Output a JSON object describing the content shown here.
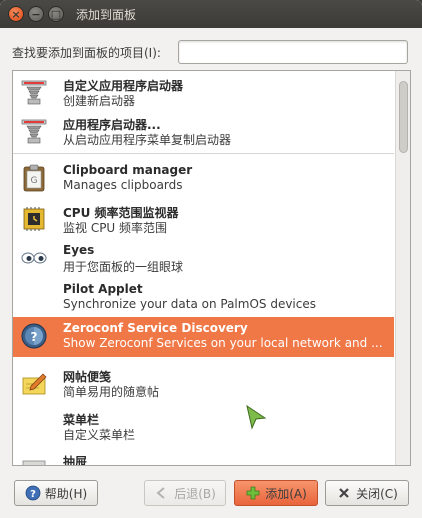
{
  "window": {
    "title": "添加到面板",
    "close_glyph": "×",
    "min_glyph": "−",
    "max_glyph": "□"
  },
  "search": {
    "label": "查找要添加到面板的项目(I):",
    "value": "",
    "placeholder": ""
  },
  "items": [
    {
      "name": "自定义应用程序启动器",
      "desc": "创建新启动器",
      "icon": "launcher-icon"
    },
    {
      "name": "应用程序启动器...",
      "desc": "从启动应用程序菜单复制启动器",
      "icon": "launcher-icon"
    },
    {
      "name": "Clipboard manager",
      "desc": "Manages clipboards",
      "icon": "clipboard-icon"
    },
    {
      "name": "CPU 频率范围监视器",
      "desc": "监视 CPU 频率范围",
      "icon": "cpu-chip-icon"
    },
    {
      "name": "Eyes",
      "desc": "用于您面板的一组眼球",
      "icon": "eyes-icon"
    },
    {
      "name": "Pilot Applet",
      "desc": "Synchronize your data on PalmOS devices",
      "icon": ""
    },
    {
      "name": "Zeroconf Service Discovery",
      "desc": "Show Zeroconf Services on your local network and ...",
      "icon": "network-globe-icon",
      "selected": true
    },
    {
      "name": "网帖便笺",
      "desc": "简单易用的随意帖",
      "icon": "notes-pencil-icon"
    },
    {
      "name": "菜单栏",
      "desc": "自定义菜单栏",
      "icon": ""
    },
    {
      "name": "抽屉",
      "desc": "",
      "icon": "drawer-icon"
    }
  ],
  "buttons": {
    "help": "帮助(H)",
    "back": "后退(B)",
    "add": "添加(A)",
    "close": "关闭(C)"
  },
  "colors": {
    "selection": "#f07746",
    "titlebar": "#3c3b37",
    "window_bg": "#f2f1f0"
  }
}
